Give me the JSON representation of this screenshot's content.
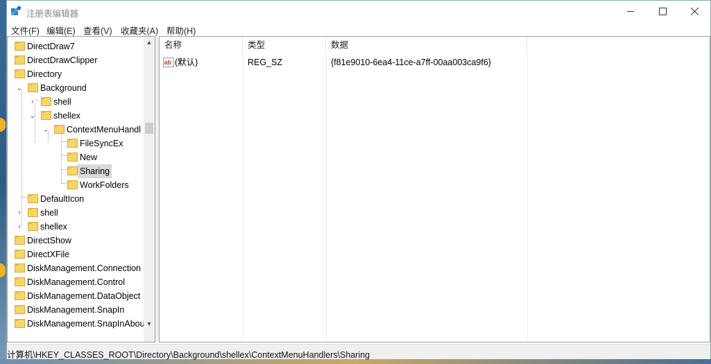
{
  "window": {
    "title": "注册表编辑器"
  },
  "menu": [
    "文件(F)",
    "编辑(E)",
    "查看(V)",
    "收藏夹(A)",
    "帮助(H)"
  ],
  "tree": [
    {
      "label": "DirectDraw7",
      "level": 0,
      "toggle": ""
    },
    {
      "label": "DirectDrawClipper",
      "level": 0,
      "toggle": ""
    },
    {
      "label": "Directory",
      "level": 0,
      "toggle": ""
    },
    {
      "label": "Background",
      "level": 1,
      "toggle": "expanded"
    },
    {
      "label": "shell",
      "level": 2,
      "toggle": "collapsed"
    },
    {
      "label": "shellex",
      "level": 2,
      "toggle": "expanded"
    },
    {
      "label": "ContextMenuHandl",
      "level": 3,
      "toggle": "expanded"
    },
    {
      "label": "FileSyncEx",
      "level": 4,
      "toggle": ""
    },
    {
      "label": "New",
      "level": 4,
      "toggle": ""
    },
    {
      "label": "Sharing",
      "level": 4,
      "toggle": "",
      "selected": true
    },
    {
      "label": "WorkFolders",
      "level": 4,
      "toggle": ""
    },
    {
      "label": "DefaultIcon",
      "level": 1,
      "toggle": ""
    },
    {
      "label": "shell",
      "level": 1,
      "toggle": "collapsed"
    },
    {
      "label": "shellex",
      "level": 1,
      "toggle": "collapsed"
    },
    {
      "label": "DirectShow",
      "level": 0,
      "toggle": ""
    },
    {
      "label": "DirectXFile",
      "level": 0,
      "toggle": ""
    },
    {
      "label": "DiskManagement.Connection",
      "level": 0,
      "toggle": ""
    },
    {
      "label": "DiskManagement.Control",
      "level": 0,
      "toggle": ""
    },
    {
      "label": "DiskManagement.DataObject",
      "level": 0,
      "toggle": ""
    },
    {
      "label": "DiskManagement.SnapIn",
      "level": 0,
      "toggle": ""
    },
    {
      "label": "DiskManagement.SnapInAbout",
      "level": 0,
      "toggle": ""
    }
  ],
  "list": {
    "columns": [
      "名称",
      "类型",
      "数据"
    ],
    "rows": [
      {
        "icon": "string-value-icon",
        "icon_text": "ab",
        "name": "(默认)",
        "type": "REG_SZ",
        "data": "{f81e9010-6ea4-11ce-a7ff-00aa003ca9f6}"
      }
    ]
  },
  "status": {
    "path": "计算机\\HKEY_CLASSES_ROOT\\Directory\\Background\\shellex\\ContextMenuHandlers\\Sharing"
  },
  "colors": {
    "selection": "#d9d9d9",
    "folder": "#f6d66a",
    "desktop": "#3d6f9c"
  }
}
